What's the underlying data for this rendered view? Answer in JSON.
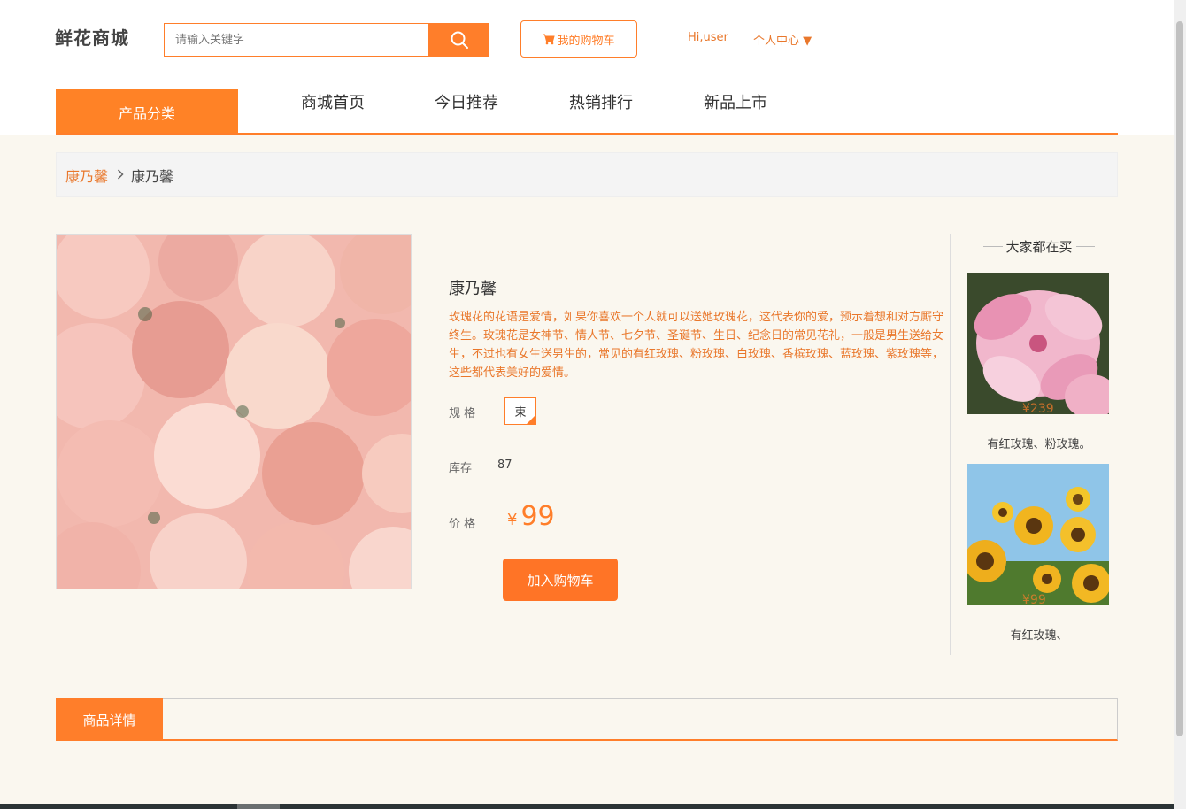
{
  "header": {
    "logo": "鲜花商城",
    "search_placeholder": "请输入关键字",
    "cart_label": "我的购物车",
    "greeting": "Hi,user",
    "user_center": "个人中心 ▼"
  },
  "nav": {
    "category_label": "产品分类",
    "items": [
      "商城首页",
      "今日推荐",
      "热销排行",
      "新品上市"
    ]
  },
  "breadcrumb": {
    "link": "康乃馨",
    "current": "康乃馨"
  },
  "product": {
    "title": "康乃馨",
    "description": "玫瑰花的花语是爱情，如果你喜欢一个人就可以送她玫瑰花，这代表你的爱，预示着想和对方厮守终生。玫瑰花是女神节、情人节、七夕节、圣诞节、生日、纪念日的常见花礼，一般是男生送给女生，不过也有女生送男生的，常见的有红玫瑰、粉玫瑰、白玫瑰、香槟玫瑰、蓝玫瑰、紫玫瑰等，这些都代表美好的爱情。",
    "spec_label": "规 格",
    "spec_value": "束",
    "stock_label": "库存",
    "stock_value": "87",
    "price_label": "价 格",
    "currency": "¥",
    "price": "99",
    "add_to_cart": "加入购物车"
  },
  "sidebar": {
    "title": "大家都在买",
    "items": [
      {
        "price": "¥239",
        "desc": "有红玫瑰、粉玫瑰。"
      },
      {
        "price": "¥99",
        "desc": "有红玫瑰、"
      }
    ]
  },
  "detail": {
    "tab_label": "商品详情"
  },
  "colors": {
    "accent": "#ff7e2a",
    "background": "#faf7ef"
  }
}
